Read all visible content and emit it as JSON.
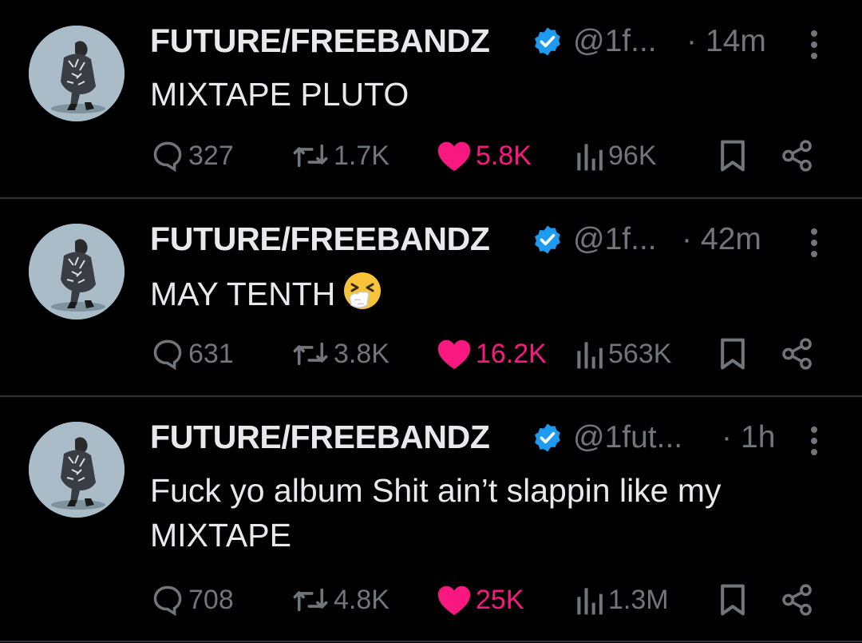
{
  "colors": {
    "background": "#000000",
    "text": "#e7e9ea",
    "muted": "#71767b",
    "like": "#f91880",
    "verified": "#1d9bf0",
    "divider": "#2f3336"
  },
  "tweets": [
    {
      "author_name": "FUTURE/FREEBANDZ",
      "handle": "@1f...",
      "separator": "·",
      "time": "14m",
      "text": "MIXTAPE PLUTO",
      "replies": "327",
      "reposts": "1.7K",
      "likes": "5.8K",
      "views": "96K",
      "liked": true
    },
    {
      "author_name": "FUTURE/FREEBANDZ",
      "handle": "@1f...",
      "separator": "·",
      "time": "42m",
      "text": "MAY TENTH",
      "emoji": "sneezing-face-emoji",
      "replies": "631",
      "reposts": "3.8K",
      "likes": "16.2K",
      "views": "563K",
      "liked": true
    },
    {
      "author_name": "FUTURE/FREEBANDZ",
      "handle": "@1fut...",
      "separator": "·",
      "time": "1h",
      "text": "Fuck yo album Shit ain’t slappin like my MIXTAPE",
      "replies": "708",
      "reposts": "4.8K",
      "likes": "25K",
      "views": "1.3M",
      "liked": true
    }
  ],
  "icons": {
    "reply": "reply-icon",
    "repost": "repost-icon",
    "like": "heart-icon",
    "views": "views-icon",
    "bookmark": "bookmark-icon",
    "share": "share-icon",
    "more": "more-vertical-icon",
    "verified": "verified-badge-icon"
  }
}
